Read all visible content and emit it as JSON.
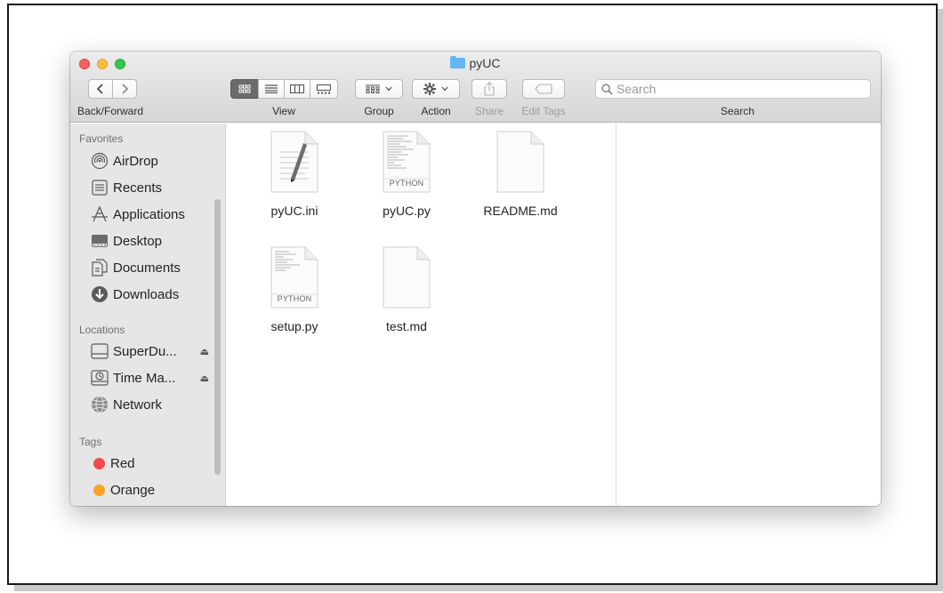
{
  "window": {
    "title": "pyUC"
  },
  "toolbar": {
    "back_forward_label": "Back/Forward",
    "view_label": "View",
    "group_label": "Group",
    "action_label": "Action",
    "share_label": "Share",
    "edit_tags_label": "Edit Tags",
    "search_label": "Search",
    "search_placeholder": "Search"
  },
  "sidebar": {
    "favorites_header": "Favorites",
    "favorites": [
      {
        "label": "AirDrop",
        "icon": "airdrop-icon"
      },
      {
        "label": "Recents",
        "icon": "recents-icon"
      },
      {
        "label": "Applications",
        "icon": "applications-icon"
      },
      {
        "label": "Desktop",
        "icon": "desktop-icon"
      },
      {
        "label": "Documents",
        "icon": "documents-icon"
      },
      {
        "label": "Downloads",
        "icon": "downloads-icon"
      }
    ],
    "locations_header": "Locations",
    "locations": [
      {
        "label": "SuperDu...",
        "icon": "drive-icon"
      },
      {
        "label": "Time Ma...",
        "icon": "time-machine-icon"
      },
      {
        "label": "Network",
        "icon": "network-icon"
      }
    ],
    "tags_header": "Tags",
    "tags": [
      {
        "label": "Red",
        "color": "#f04a4a"
      },
      {
        "label": "Orange",
        "color": "#f5a524"
      }
    ]
  },
  "files": [
    {
      "name": "pyUC.ini",
      "kind": "ini"
    },
    {
      "name": "pyUC.py",
      "kind": "python",
      "badge": "PYTHON"
    },
    {
      "name": "README.md",
      "kind": "blank"
    },
    {
      "name": "setup.py",
      "kind": "python",
      "badge": "PYTHON"
    },
    {
      "name": "test.md",
      "kind": "blank"
    }
  ]
}
